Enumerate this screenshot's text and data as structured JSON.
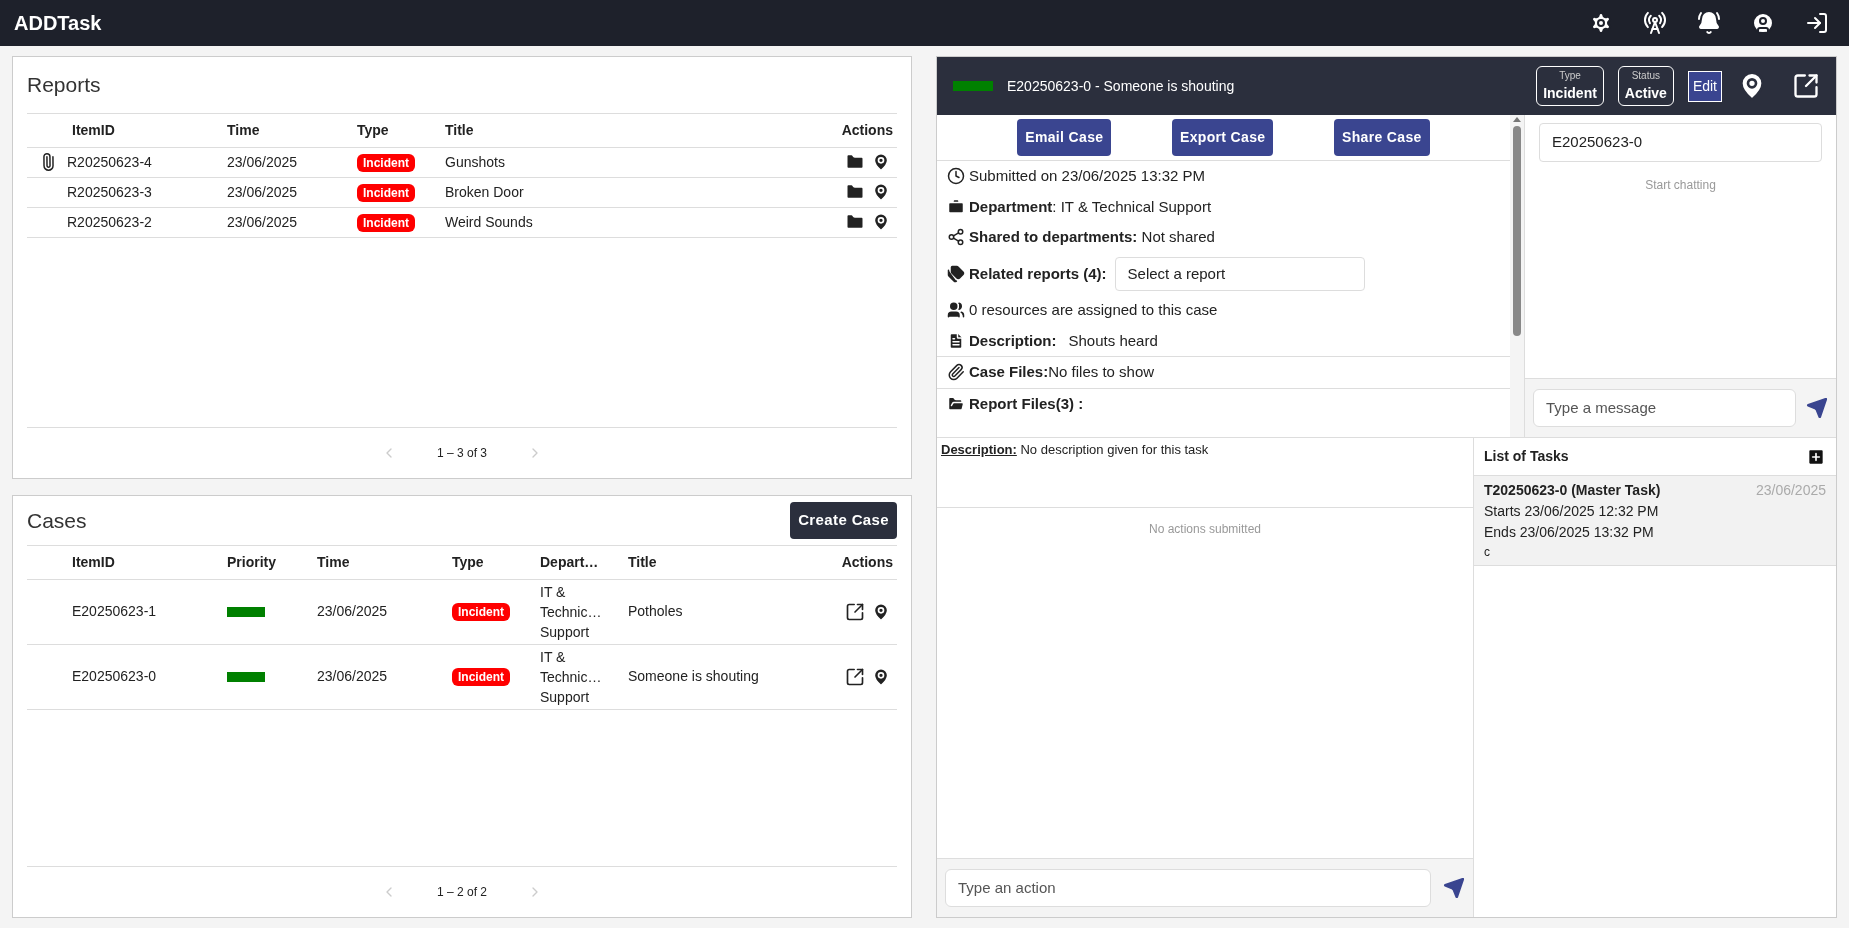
{
  "app": {
    "title": "ADDTask"
  },
  "reports": {
    "title": "Reports",
    "columns": [
      "ItemID",
      "Time",
      "Type",
      "Title",
      "Actions"
    ],
    "rows": [
      {
        "id": "R20250623-4",
        "time": "23/06/2025",
        "type": "Incident",
        "title": "Gunshots",
        "attachment": true
      },
      {
        "id": "R20250623-3",
        "time": "23/06/2025",
        "type": "Incident",
        "title": "Broken Door",
        "attachment": false
      },
      {
        "id": "R20250623-2",
        "time": "23/06/2025",
        "type": "Incident",
        "title": "Weird Sounds",
        "attachment": false
      }
    ],
    "pagination": "1 – 3 of 3"
  },
  "cases": {
    "title": "Cases",
    "create_button": "Create Case",
    "columns": [
      "ItemID",
      "Priority",
      "Time",
      "Type",
      "Depart…",
      "Title",
      "Actions"
    ],
    "rows": [
      {
        "id": "E20250623-1",
        "color": "#008000",
        "time": "23/06/2025",
        "type": "Incident",
        "department": "IT & Technic… Support",
        "title": "Potholes"
      },
      {
        "id": "E20250623-0",
        "color": "#008000",
        "time": "23/06/2025",
        "type": "Incident",
        "department": "IT & Technic… Support",
        "title": "Someone is shouting"
      }
    ],
    "pagination": "1 – 2 of 2"
  },
  "case_detail": {
    "color": "#008000",
    "heading": "E20250623-0 - Someone is shouting",
    "type_label": "Type",
    "type": "Incident",
    "status_label": "Status",
    "status": "Active",
    "edit_button": "Edit",
    "buttons": [
      "Email Case",
      "Export Case",
      "Share Case"
    ],
    "fields": [
      {
        "kind": "submitted",
        "text": "Submitted on 23/06/2025 13:32 PM"
      },
      {
        "kind": "department",
        "text": "**Department**: IT & Technical Support"
      },
      {
        "kind": "shared",
        "text": "**Shared to departments:** Not shared"
      },
      {
        "kind": "related",
        "label": "Related reports (4):",
        "placeholder": "Select a report"
      },
      {
        "kind": "resources",
        "text": "0 resources are assigned to this case"
      },
      {
        "kind": "description",
        "label": "Description:",
        "value": "Shouts heard"
      },
      {
        "kind": "case_files",
        "text": "**Case Files:**No files to show"
      },
      {
        "kind": "report_files",
        "text": "**Report Files(3) :**"
      }
    ]
  },
  "chat": {
    "value": "E20250623-0",
    "empty": "Start chatting",
    "placeholder": "Type a message"
  },
  "actions": {
    "description_label": "Description:",
    "description": "No description given for this task",
    "empty": "No actions submitted",
    "placeholder": "Type an action"
  },
  "tasks": {
    "title": "List of Tasks",
    "items": [
      {
        "title": "T20250623-0 (Master Task)",
        "date": "23/06/2025",
        "starts": "Starts 23/06/2025 12:32 PM",
        "ends": "Ends 23/06/2025 13:32 PM",
        "note": "c",
        "selected": true
      }
    ]
  }
}
